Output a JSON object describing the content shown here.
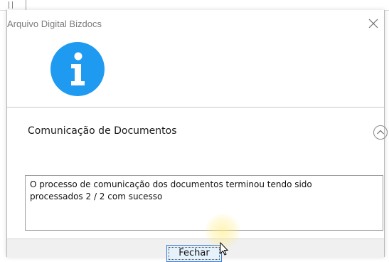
{
  "dialog": {
    "title": "Arquivo Digital Bizdocs",
    "icon": "info-icon",
    "section_title": "Comunicação de Documentos",
    "message": "O processo de comunicação dos documentos terminou tendo sido\nprocessados 2 / 2 com sucesso",
    "close_button_label": "Fechar"
  },
  "colors": {
    "accent": "#1e9bf0",
    "title_text": "#7d7d7d",
    "footer_bg": "#f0f0f0",
    "button_border": "#3c7fd6"
  }
}
